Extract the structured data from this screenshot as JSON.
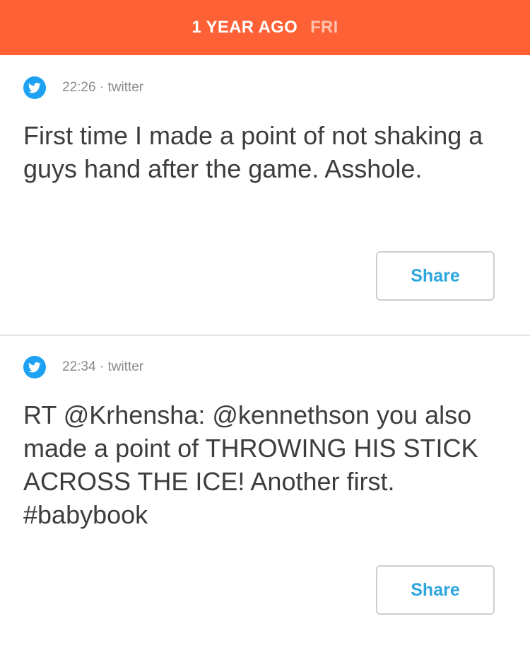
{
  "header": {
    "when": "1 YEAR AGO",
    "day": "FRI",
    "accent_color": "#ff6136"
  },
  "posts": [
    {
      "icon": "twitter-icon",
      "time": "22:26",
      "source": "twitter",
      "text": "First time I made a point of not shaking a guys hand after the game. Asshole.",
      "share_label": "Share"
    },
    {
      "icon": "twitter-icon",
      "time": "22:34",
      "source": "twitter",
      "text": "RT @Krhensha: @kennethson you also made a point of THROWING HIS STICK ACROSS THE ICE! Another first. #babybook",
      "share_label": "Share"
    }
  ],
  "colors": {
    "twitter_blue": "#1da1f2",
    "share_text": "#2ea6de"
  }
}
